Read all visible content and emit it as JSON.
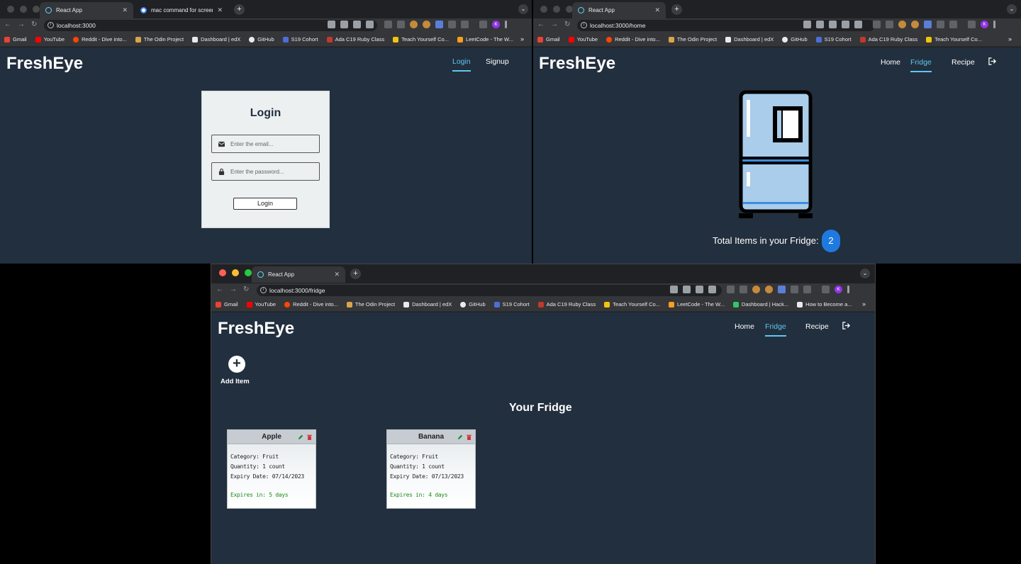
{
  "colors": {
    "page_bg": "#222f3e",
    "accent": "#5ec8f0",
    "badge": "#1f7ae0",
    "expire_text": "#1a8a1a"
  },
  "bookmarks": [
    "Gmail",
    "YouTube",
    "Reddit - Dive into...",
    "The Odin Project",
    "Dashboard | edX",
    "GitHub",
    "S19 Cohort",
    "Ada C19 Ruby Class",
    "Teach Yourself Co...",
    "LeetCode - The W..."
  ],
  "bookmarks_front": [
    "Gmail",
    "YouTube",
    "Reddit - Dive into...",
    "The Odin Project",
    "Dashboard | edX",
    "GitHub",
    "S19 Cohort",
    "Ada C19 Ruby Class",
    "Teach Yourself Co...",
    "LeetCode - The W...",
    "Dashboard | Hack...",
    "How to Become a..."
  ],
  "left_window": {
    "tabs": [
      {
        "title": "React App",
        "icon": "react-icon"
      },
      {
        "title": "mac command for screen rec",
        "icon": "google-icon"
      }
    ],
    "url": "localhost:3000",
    "app": {
      "logo": "FreshEye",
      "nav": {
        "login": "Login",
        "signup": "Signup"
      },
      "login_card": {
        "title": "Login",
        "email_placeholder": "Enter the email...",
        "password_placeholder": "Enter the password...",
        "button": "Login"
      }
    }
  },
  "right_window": {
    "tabs": [
      {
        "title": "React App",
        "icon": "react-icon"
      }
    ],
    "url": "localhost:3000/home",
    "app": {
      "logo": "FreshEye",
      "nav": {
        "home": "Home",
        "fridge": "Fridge",
        "recipe": "Recipe"
      },
      "total_label": "Total Items in your Fridge:",
      "total_count": "2"
    }
  },
  "front_window": {
    "tabs": [
      {
        "title": "React App",
        "icon": "react-icon"
      }
    ],
    "url": "localhost:3000/fridge",
    "app": {
      "logo": "FreshEye",
      "nav": {
        "home": "Home",
        "fridge": "Fridge",
        "recipe": "Recipe"
      },
      "add_item_label": "Add Item",
      "section_title": "Your Fridge",
      "items": [
        {
          "name": "Apple",
          "category": "Category: Fruit",
          "quantity": "Quantity: 1 count",
          "expiry": "Expiry Date: 07/14/2023",
          "expires_in": "Expires in: 5 days"
        },
        {
          "name": "Banana",
          "category": "Category: Fruit",
          "quantity": "Quantity: 1 count",
          "expiry": "Expiry Date: 07/13/2023",
          "expires_in": "Expires in: 4 days"
        }
      ]
    }
  }
}
